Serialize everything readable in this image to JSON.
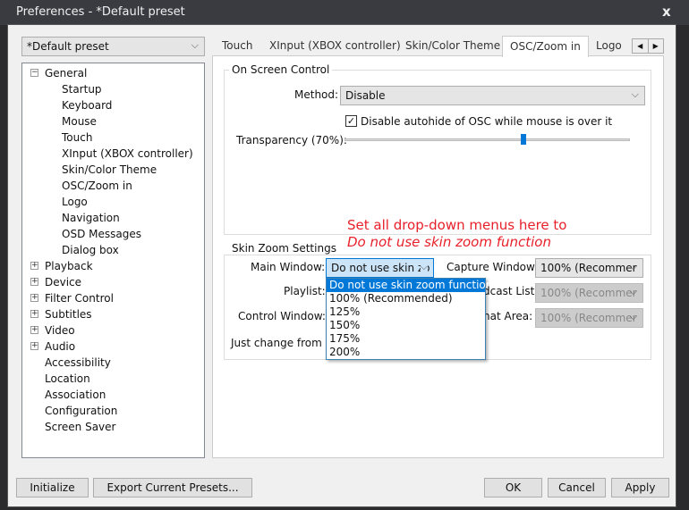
{
  "window": {
    "title": "Preferences - *Default preset",
    "close": "x"
  },
  "preset": {
    "value": "*Default preset"
  },
  "tree": [
    {
      "label": "General",
      "expanded": true,
      "children": [
        "Startup",
        "Keyboard",
        "Mouse",
        "Touch",
        "XInput (XBOX controller)",
        "Skin/Color Theme",
        "OSC/Zoom in",
        "Logo",
        "Navigation",
        "OSD Messages",
        "Dialog box"
      ]
    },
    {
      "label": "Playback"
    },
    {
      "label": "Device"
    },
    {
      "label": "Filter Control"
    },
    {
      "label": "Subtitles"
    },
    {
      "label": "Video"
    },
    {
      "label": "Audio"
    },
    {
      "label": "Accessibility",
      "leaf": true
    },
    {
      "label": "Location",
      "leaf": true
    },
    {
      "label": "Association",
      "leaf": true
    },
    {
      "label": "Configuration",
      "leaf": true
    },
    {
      "label": "Screen Saver",
      "leaf": true
    }
  ],
  "tabs": [
    "Touch",
    "XInput (XBOX controller)",
    "Skin/Color Theme",
    "OSC/Zoom in",
    "Logo"
  ],
  "active_tab": "OSC/Zoom in",
  "osc": {
    "group": "On Screen Control",
    "method_label": "Method:",
    "method_value": "Disable",
    "autohide_label": "Disable autohide of OSC while mouse is over it",
    "autohide_checked": true,
    "transparency_label": "Transparency (70%):",
    "transparency_value": 70
  },
  "annotation": {
    "line1": "Set all drop-down menus here to",
    "line2": "Do not use skin zoom function"
  },
  "zoom": {
    "group": "Skin Zoom Settings",
    "main_label": "Main Window:",
    "main_value": "Do not use skin zo",
    "capture_label": "Capture Window:",
    "capture_value": "100% (Recommer",
    "playlist_label": "Playlist:",
    "broadcast_label": "dcast List:",
    "broadcast_value": "100% (Recommer",
    "control_label": "Control Window:",
    "chat_label": "hat Area:",
    "chat_value": "100% (Recommer",
    "note": "Just change from \"d",
    "options": [
      "Do not use skin zoom function",
      "100% (Recommended)",
      "125%",
      "150%",
      "175%",
      "200%"
    ]
  },
  "buttons": {
    "initialize": "Initialize",
    "export": "Export Current Presets...",
    "ok": "OK",
    "cancel": "Cancel",
    "apply": "Apply"
  }
}
